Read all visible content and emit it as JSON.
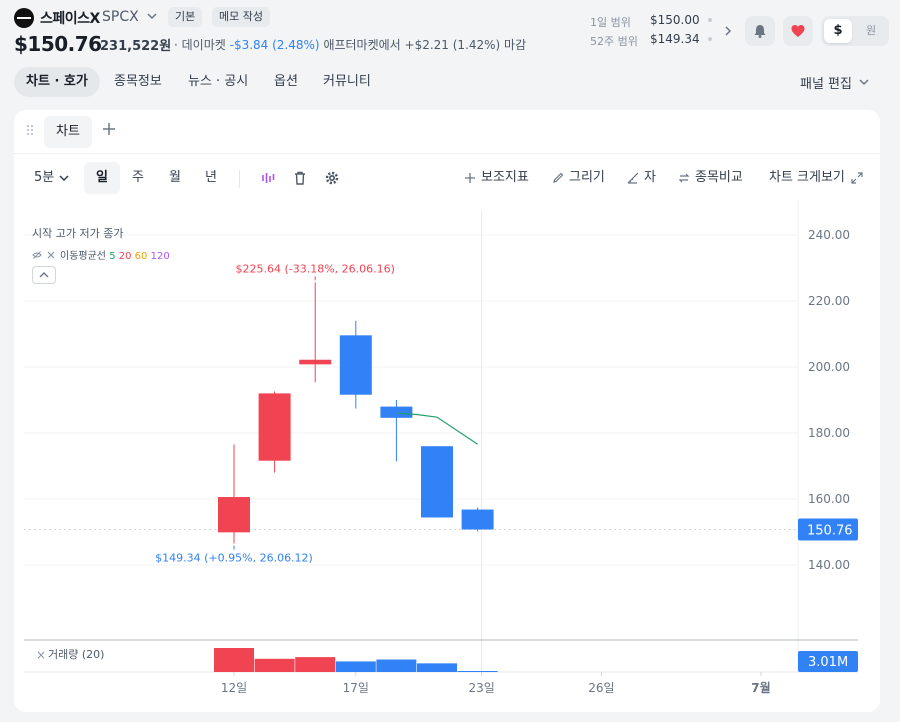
{
  "header": {
    "stock_name": "스페이스X",
    "ticker": "SPCX",
    "chip_basic": "기본",
    "chip_memo": "메모 작성",
    "price": "$150.76",
    "volume_krw": "231,522원",
    "daymarket_label": "· 데이마켓",
    "daymarket_change": "-$3.84 (2.48%)",
    "aftermarket_text": "애프터마켓에서 +$2.21 (1.42%) 마감",
    "range_1d_label": "1일 범위",
    "range_1d_value": "$150.00",
    "range_52w_label": "52주 범위",
    "range_52w_value": "$149.34",
    "currency_usd": "$",
    "currency_krw": "원"
  },
  "tabs": [
    "차트 · 호가",
    "종목정보",
    "뉴스 · 공시",
    "옵션",
    "커뮤니티"
  ],
  "panel_edit": "패널 편집",
  "chart_panel": {
    "tab_label": "차트",
    "interval": "5분",
    "periods": [
      "일",
      "주",
      "월",
      "년"
    ],
    "tools": {
      "indicator": "보조지표",
      "draw": "그리기",
      "ruler": "자",
      "compare": "종목비교",
      "expand": "차트 크게보기"
    },
    "ohlc_label": "시작 고가 저가 종가",
    "ma_label": "이동평균선",
    "ma_periods": [
      "5",
      "20",
      "60",
      "120"
    ],
    "volume_label": "거래량 (20)",
    "high_annotation": "$225.64 (-33.18%, 26.06.16)",
    "low_annotation": "$149.34 (+0.95%, 26.06.12)",
    "current_price_label": "150.76",
    "current_volume_label": "3.01M"
  },
  "colors": {
    "up": "#f04452",
    "down": "#3182f6",
    "ma5": "#22a06b",
    "price_tag": "#3182f6"
  },
  "chart_data": {
    "type": "candlestick",
    "y_ticks": [
      "240.00",
      "220.00",
      "200.00",
      "180.00",
      "160.00",
      "140.00"
    ],
    "ylim": [
      122,
      254
    ],
    "x_ticks": [
      "12일",
      "17일",
      "23일",
      "26일",
      "7월"
    ],
    "candles": [
      {
        "open": 149.9,
        "high": 176.5,
        "low": 146.5,
        "close": 160.6,
        "direction": "up"
      },
      {
        "open": 171.6,
        "high": 192.6,
        "low": 168.0,
        "close": 192.0,
        "direction": "up"
      },
      {
        "open": 200.8,
        "high": 225.64,
        "low": 195.4,
        "close": 202.2,
        "direction": "up"
      },
      {
        "open": 209.6,
        "high": 214.0,
        "low": 187.4,
        "close": 191.6,
        "direction": "down"
      },
      {
        "open": 188.0,
        "high": 190.0,
        "low": 171.4,
        "close": 184.6,
        "direction": "down"
      },
      {
        "open": 176.0,
        "high": 176.0,
        "low": 154.4,
        "close": 154.4,
        "direction": "down"
      },
      {
        "open": 156.8,
        "high": 157.4,
        "low": 150.2,
        "close": 150.76,
        "direction": "down"
      }
    ],
    "ma5": [
      {
        "index": 4,
        "value": 186.0
      },
      {
        "index": 4.5,
        "value": 185.6
      },
      {
        "index": 5,
        "value": 184.8
      },
      {
        "index": 6,
        "value": 176.6
      }
    ],
    "volume": [
      {
        "value": 1.0,
        "direction": "up"
      },
      {
        "value": 0.55,
        "direction": "up"
      },
      {
        "value": 0.62,
        "direction": "up"
      },
      {
        "value": 0.44,
        "direction": "down"
      },
      {
        "value": 0.52,
        "direction": "down"
      },
      {
        "value": 0.36,
        "direction": "down"
      },
      {
        "value": 0.04,
        "direction": "down"
      }
    ],
    "current_price": 150.76
  }
}
